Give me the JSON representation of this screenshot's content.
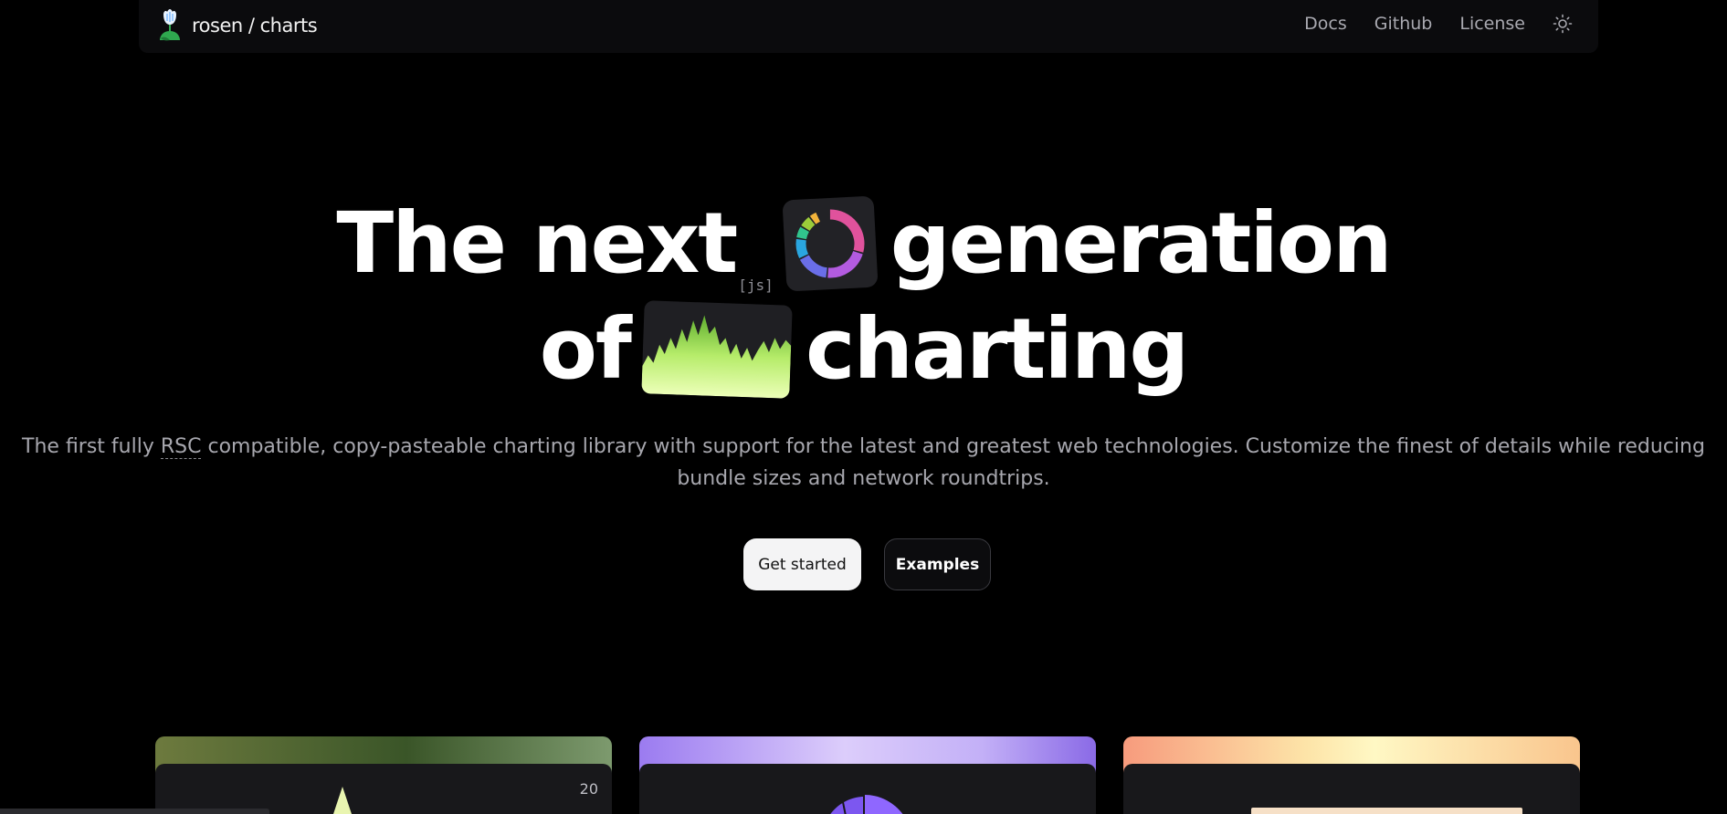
{
  "nav": {
    "brand": "rosen / charts",
    "links": [
      "Docs",
      "Github",
      "License"
    ]
  },
  "hero": {
    "line1_part1": "The next",
    "js_tag": "[js]",
    "line1_part2": "generation",
    "line2_part1": "of",
    "line2_part2": "charting",
    "subtitle_before": "The first fully ",
    "subtitle_abbr": "RSC",
    "subtitle_after": " compatible, copy-pasteable charting library with support for the latest and greatest web technologies. Customize the finest of details while reducing bundle sizes and network roundtrips."
  },
  "buttons": {
    "primary": "Get started",
    "secondary": "Examples"
  },
  "cards": {
    "card1_value": "20"
  },
  "icons": {
    "brand": "tulip-logo-icon",
    "theme": "sun-icon",
    "donut_tile": "donut-chart-icon",
    "area_tile": "area-chart-icon"
  },
  "colors": {
    "background": "#000000",
    "area_fill": "#c8f57a",
    "donut": [
      "#e0529c",
      "#b35be0",
      "#6a6ee8",
      "#2aa6e0",
      "#31c48d",
      "#9ccc3a",
      "#f2b33b"
    ]
  }
}
